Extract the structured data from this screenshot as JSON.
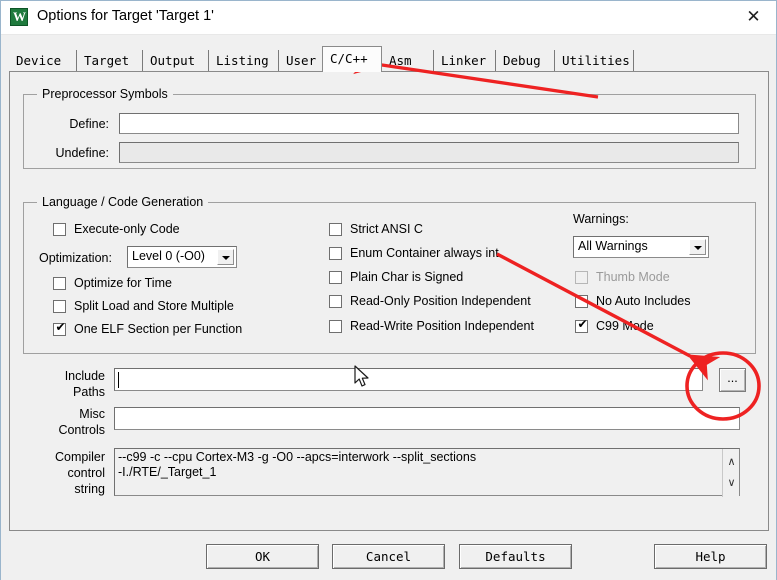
{
  "window": {
    "title": "Options for Target 'Target 1'",
    "icon": "keil-uvision-icon",
    "close_label": "✕"
  },
  "tabs": [
    {
      "label": "Device",
      "active": false
    },
    {
      "label": "Target",
      "active": false
    },
    {
      "label": "Output",
      "active": false
    },
    {
      "label": "Listing",
      "active": false
    },
    {
      "label": "User",
      "active": false
    },
    {
      "label": "C/C++",
      "active": true
    },
    {
      "label": "Asm",
      "active": false
    },
    {
      "label": "Linker",
      "active": false
    },
    {
      "label": "Debug",
      "active": false
    },
    {
      "label": "Utilities",
      "active": false
    }
  ],
  "preprocessor": {
    "group_title": "Preprocessor Symbols",
    "define_label": "Define:",
    "define_value": "",
    "undefine_label": "Undefine:",
    "undefine_value": ""
  },
  "language": {
    "group_title": "Language / Code Generation",
    "optimization_label": "Optimization:",
    "optimization_value": "Level 0 (-O0)",
    "warnings_label": "Warnings:",
    "warnings_value": "All Warnings",
    "left_options": [
      {
        "label": "Execute-only Code",
        "checked": false,
        "disabled": false
      },
      {
        "label": "Optimize for Time",
        "checked": false,
        "disabled": false
      },
      {
        "label": "Split Load and Store Multiple",
        "checked": false,
        "disabled": false
      },
      {
        "label": "One ELF Section per Function",
        "checked": true,
        "disabled": false
      }
    ],
    "middle_options": [
      {
        "label": "Strict ANSI C",
        "checked": false,
        "disabled": false
      },
      {
        "label": "Enum Container always int",
        "checked": false,
        "disabled": false
      },
      {
        "label": "Plain Char is Signed",
        "checked": false,
        "disabled": false
      },
      {
        "label": "Read-Only Position Independent",
        "checked": false,
        "disabled": false
      },
      {
        "label": "Read-Write Position Independent",
        "checked": false,
        "disabled": false
      }
    ],
    "right_options": [
      {
        "label": "Thumb Mode",
        "checked": false,
        "disabled": true
      },
      {
        "label": "No Auto Includes",
        "checked": false,
        "disabled": false
      },
      {
        "label": "C99 Mode",
        "checked": true,
        "disabled": false
      }
    ]
  },
  "paths": {
    "include_label_line1": "Include",
    "include_label_line2": "Paths",
    "include_value": "",
    "misc_label_line1": "Misc",
    "misc_label_line2": "Controls",
    "misc_value": "",
    "browse_label": "..."
  },
  "compiler": {
    "label_line1": "Compiler",
    "label_line2": "control",
    "label_line3": "string",
    "value_line1": "--c99 -c --cpu Cortex-M3 -g -O0 --apcs=interwork --split_sections",
    "value_line2": "-I./RTE/_Target_1",
    "scroll_up": "∧",
    "scroll_down": "∨"
  },
  "buttons": {
    "ok": "OK",
    "cancel": "Cancel",
    "defaults": "Defaults",
    "help": "Help"
  },
  "annotations": {
    "accent_color": "#ee2222",
    "arrow_to_tab": "arrow pointing at C/C++ tab",
    "arrow_to_browse": "arrow pointing at include paths browse button",
    "ellipse_on_browse": "red ellipse highlighting browse button"
  },
  "checkmark": "✔"
}
